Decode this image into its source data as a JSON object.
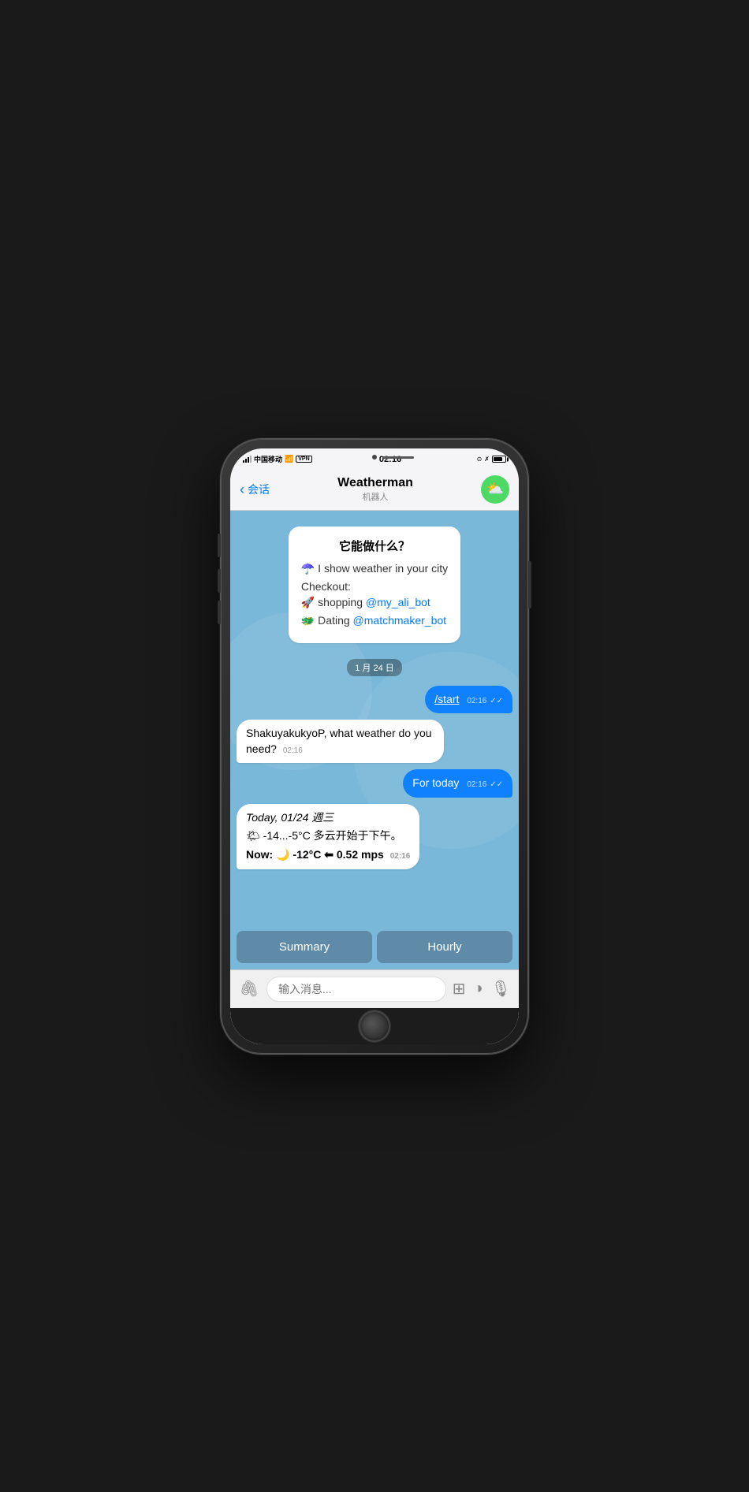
{
  "status": {
    "carrier": "中国移动",
    "time": "02:16",
    "battery_level": "80"
  },
  "nav": {
    "back_label": "会话",
    "title": "Weatherman",
    "subtitle": "机器人"
  },
  "bot_intro": {
    "title": "它能做什么？",
    "line1": "☂️ I show weather in your city",
    "checkout_label": "Checkout:",
    "shopping_text": "🚀 shopping",
    "shopping_link": "@my_ali_bot",
    "dating_text": "🐲 Dating",
    "dating_link": "@matchmaker_bot"
  },
  "date_separator": "1 月 24 日",
  "messages": [
    {
      "type": "outgoing",
      "text": "/start",
      "time": "02:16",
      "ticks": "✓✓"
    },
    {
      "type": "incoming",
      "text": "ShakuyakukyoP, what weather do you need?",
      "time": "02:16"
    },
    {
      "type": "outgoing",
      "text": "For today",
      "time": "02:16",
      "ticks": "✓✓"
    },
    {
      "type": "incoming",
      "text_parts": {
        "date": "Today, 01/24 週三",
        "temp_range": "🌤 -14...-5°C 多云开始于下午。",
        "now": "Now: 🌙 -12°C ⬅ 0.52 mps"
      },
      "time": "02:16"
    }
  ],
  "quick_replies": {
    "summary": "Summary",
    "hourly": "Hourly"
  },
  "input": {
    "placeholder": "输入消息..."
  },
  "icons": {
    "weather_bot_icon": "⛅",
    "attach_icon": "📎",
    "sticker_icon": "⊞",
    "moon_icon": "🌙",
    "mic_icon": "🎙"
  }
}
